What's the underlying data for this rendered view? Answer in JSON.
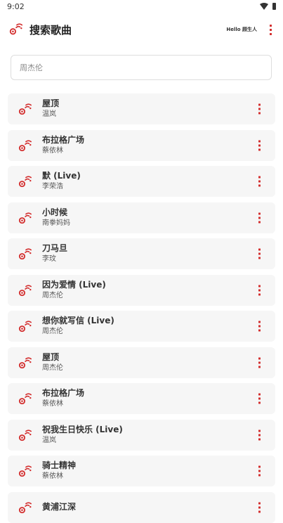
{
  "status_bar": {
    "time": "9:02"
  },
  "header": {
    "title": "搜索歌曲",
    "greeting": "Hello 顾生人"
  },
  "search": {
    "value": "",
    "placeholder": "周杰伦"
  },
  "songs": [
    {
      "title": "屋顶",
      "artist": "温岚"
    },
    {
      "title": "布拉格广场",
      "artist": "蔡依林"
    },
    {
      "title": "默 (Live)",
      "artist": "李荣浩"
    },
    {
      "title": "小时候",
      "artist": "南拳妈妈"
    },
    {
      "title": "刀马旦",
      "artist": "李玟"
    },
    {
      "title": "因为爱情 (Live)",
      "artist": "周杰伦"
    },
    {
      "title": "想你就写信 (Live)",
      "artist": "周杰伦"
    },
    {
      "title": "屋顶",
      "artist": "周杰伦"
    },
    {
      "title": "布拉格广场",
      "artist": "蔡依林"
    },
    {
      "title": "祝我生日快乐 (Live)",
      "artist": "温岚"
    },
    {
      "title": "骑士精神",
      "artist": "蔡依林"
    },
    {
      "title": "黄浦江深",
      "artist": ""
    }
  ],
  "colors": {
    "accent": "#d32f2f",
    "card_bg": "#f6f6f6"
  }
}
